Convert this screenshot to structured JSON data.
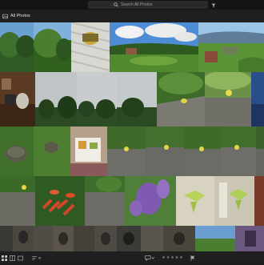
{
  "search": {
    "placeholder": "Search All Photos"
  },
  "header": {
    "title": "All Photos"
  },
  "icons": {
    "search": "search-icon",
    "filter": "filter-icon",
    "album": "album-icon"
  },
  "bottombar": {
    "rating": "★★★★★"
  },
  "colors": {
    "background": "#1b1b1c",
    "topbar": "#141415",
    "accent": "#e0e0e0"
  }
}
